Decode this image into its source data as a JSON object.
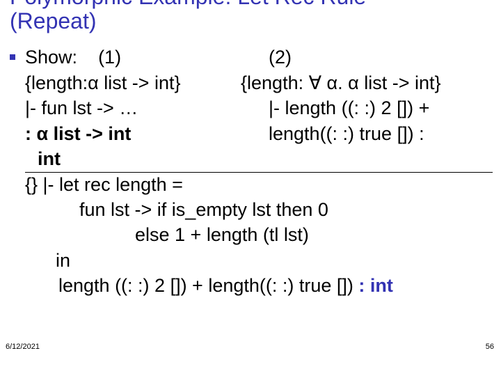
{
  "title_line1": "Polymorphic Example: Let Rec Rule",
  "title_line2": "(Repeat)",
  "show_label": "Show:",
  "num1": "(1)",
  "num2": "(2)",
  "left_env": "{length:α list -> int}",
  "right_env": "{length: ∀ α. α list -> int}",
  "left_turn": "|- fun lst -> …",
  "right_turn": "|- length ((: :) 2 []) +",
  "left_type": " : α list -> int",
  "right_call2": "length((: :) true []) :",
  "int_word": "int",
  "letrec1": "{} |- let rec length =",
  "letrec2": "fun lst -> if is_empty lst then 0",
  "letrec3": "else 1 + length (tl lst)",
  "letrec4": "in",
  "last_pre": "length ((: :) 2 []) + length((: :) true []) ",
  "last_type": ": int",
  "footer_date": "6/12/2021",
  "footer_page": "56"
}
